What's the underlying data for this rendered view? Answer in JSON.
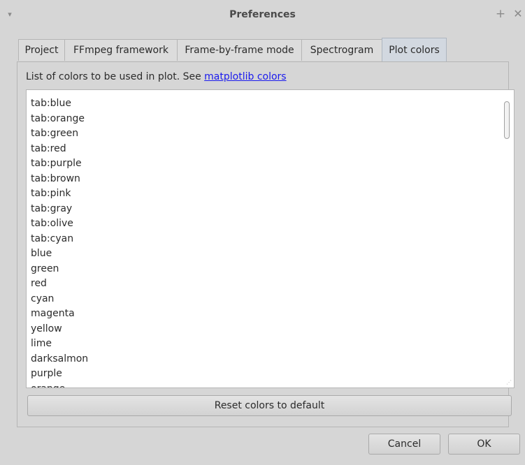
{
  "window": {
    "title": "Preferences",
    "menu_glyph": "▾",
    "maximize_glyph": "+",
    "close_glyph": "✕"
  },
  "tabs": [
    {
      "label": "Project",
      "active": false
    },
    {
      "label": "FFmpeg framework",
      "active": false
    },
    {
      "label": "Frame-by-frame mode",
      "active": false
    },
    {
      "label": "Spectrogram",
      "active": false
    },
    {
      "label": "Plot colors",
      "active": true
    }
  ],
  "plot_colors": {
    "description_prefix": "List of colors to be used in plot. See ",
    "link_text": "matplotlib colors",
    "colors": [
      "tab:blue",
      "tab:orange",
      "tab:green",
      "tab:red",
      "tab:purple",
      "tab:brown",
      "tab:pink",
      "tab:gray",
      "tab:olive",
      "tab:cyan",
      "blue",
      "green",
      "red",
      "cyan",
      "magenta",
      "yellow",
      "lime",
      "darksalmon",
      "purple",
      "orange"
    ],
    "reset_label": "Reset colors to default"
  },
  "buttons": {
    "cancel_label": "Cancel",
    "ok_label": "OK"
  }
}
